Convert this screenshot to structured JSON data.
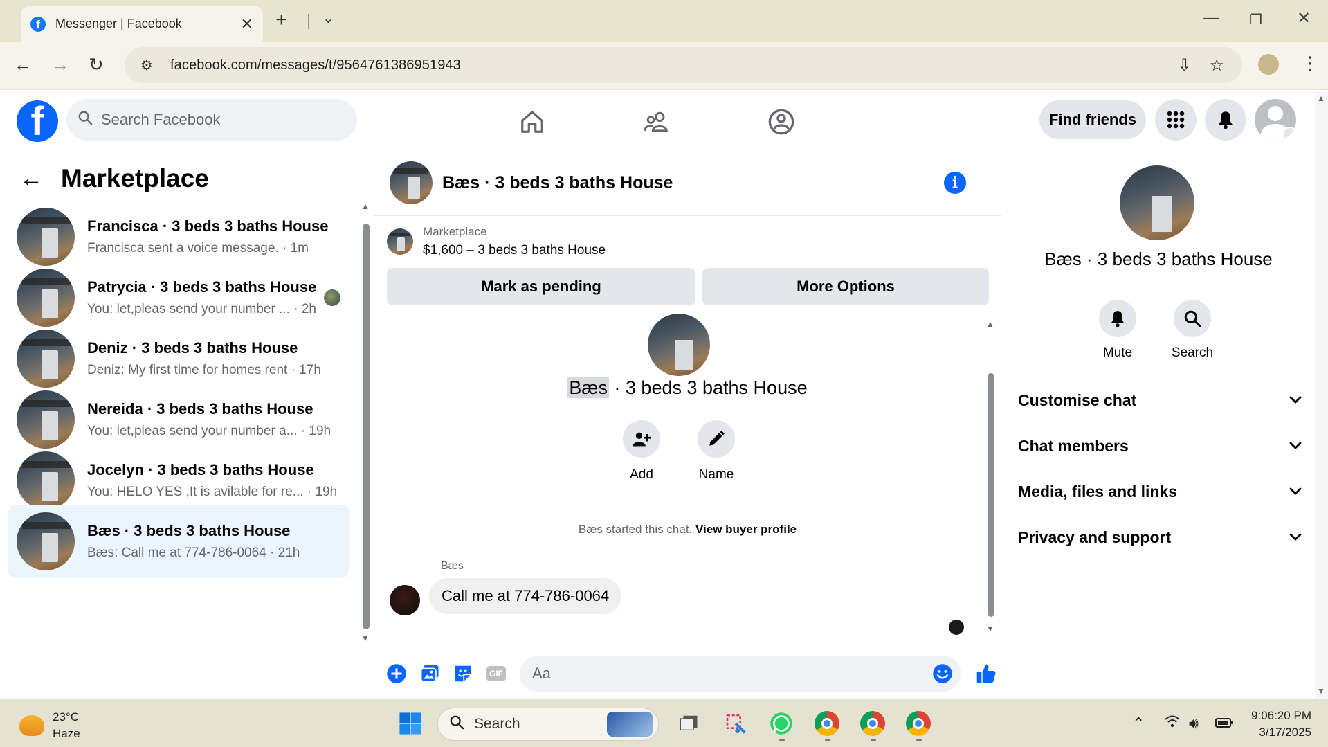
{
  "browser": {
    "tab_title": "Messenger | Facebook",
    "favicon": "f",
    "close_tab": "✕",
    "new_tab": "+",
    "url": "facebook.com/messages/t/9564761386951943"
  },
  "fb": {
    "logo": "f",
    "search_placeholder": "Search Facebook",
    "find_friends": "Find friends"
  },
  "left": {
    "title": "Marketplace",
    "chats": [
      {
        "name": "Francisca · 3 beds 3 baths House",
        "preview": "Francisca sent a voice message. · 1m"
      },
      {
        "name": "Patrycia · 3 beds 3 baths House",
        "preview": "You: let,pleas send your number ... · 2h"
      },
      {
        "name": "Deniz · 3 beds 3 baths House",
        "preview": "Deniz: My first time for homes rent · 17h"
      },
      {
        "name": "Nereida · 3 beds 3 baths House",
        "preview": "You: let,pleas send your number a... · 19h"
      },
      {
        "name": "Jocelyn · 3 beds 3 baths House",
        "preview": "You: HELO YES ,It is avilable for re... · 19h"
      },
      {
        "name": "Bæs · 3 beds 3 baths House",
        "preview": "Bæs: Call me at 774-786-0064 · 21h"
      }
    ]
  },
  "conversation": {
    "title": "Bæs · 3 beds 3 baths House",
    "marketplace_label": "Marketplace",
    "listing": "$1,600 – 3 beds 3 baths House",
    "mark_pending": "Mark as pending",
    "more_options": "More Options",
    "center_name_highlight": "Bæs",
    "center_name_rest": " · 3 beds 3 baths House",
    "add_label": "Add",
    "name_label": "Name",
    "started_text": "Bæs started this chat. ",
    "view_profile": "View buyer profile",
    "sender": "Bæs",
    "message": "Call me at 774-786-0064",
    "composer_placeholder": "Aa",
    "gif": "GIF"
  },
  "info": {
    "name": "Bæs · 3 beds 3 baths House",
    "mute": "Mute",
    "search": "Search",
    "sections": [
      "Customise chat",
      "Chat members",
      "Media, files and links",
      "Privacy and support"
    ]
  },
  "taskbar": {
    "temp": "23°C",
    "condition": "Haze",
    "search": "Search",
    "time": "9:06:20 PM",
    "date": "3/17/2025"
  },
  "colors": {
    "brand": "#0866ff",
    "active_chat": "#ebf5ff",
    "chrome_bg": "#e9e4d0"
  }
}
